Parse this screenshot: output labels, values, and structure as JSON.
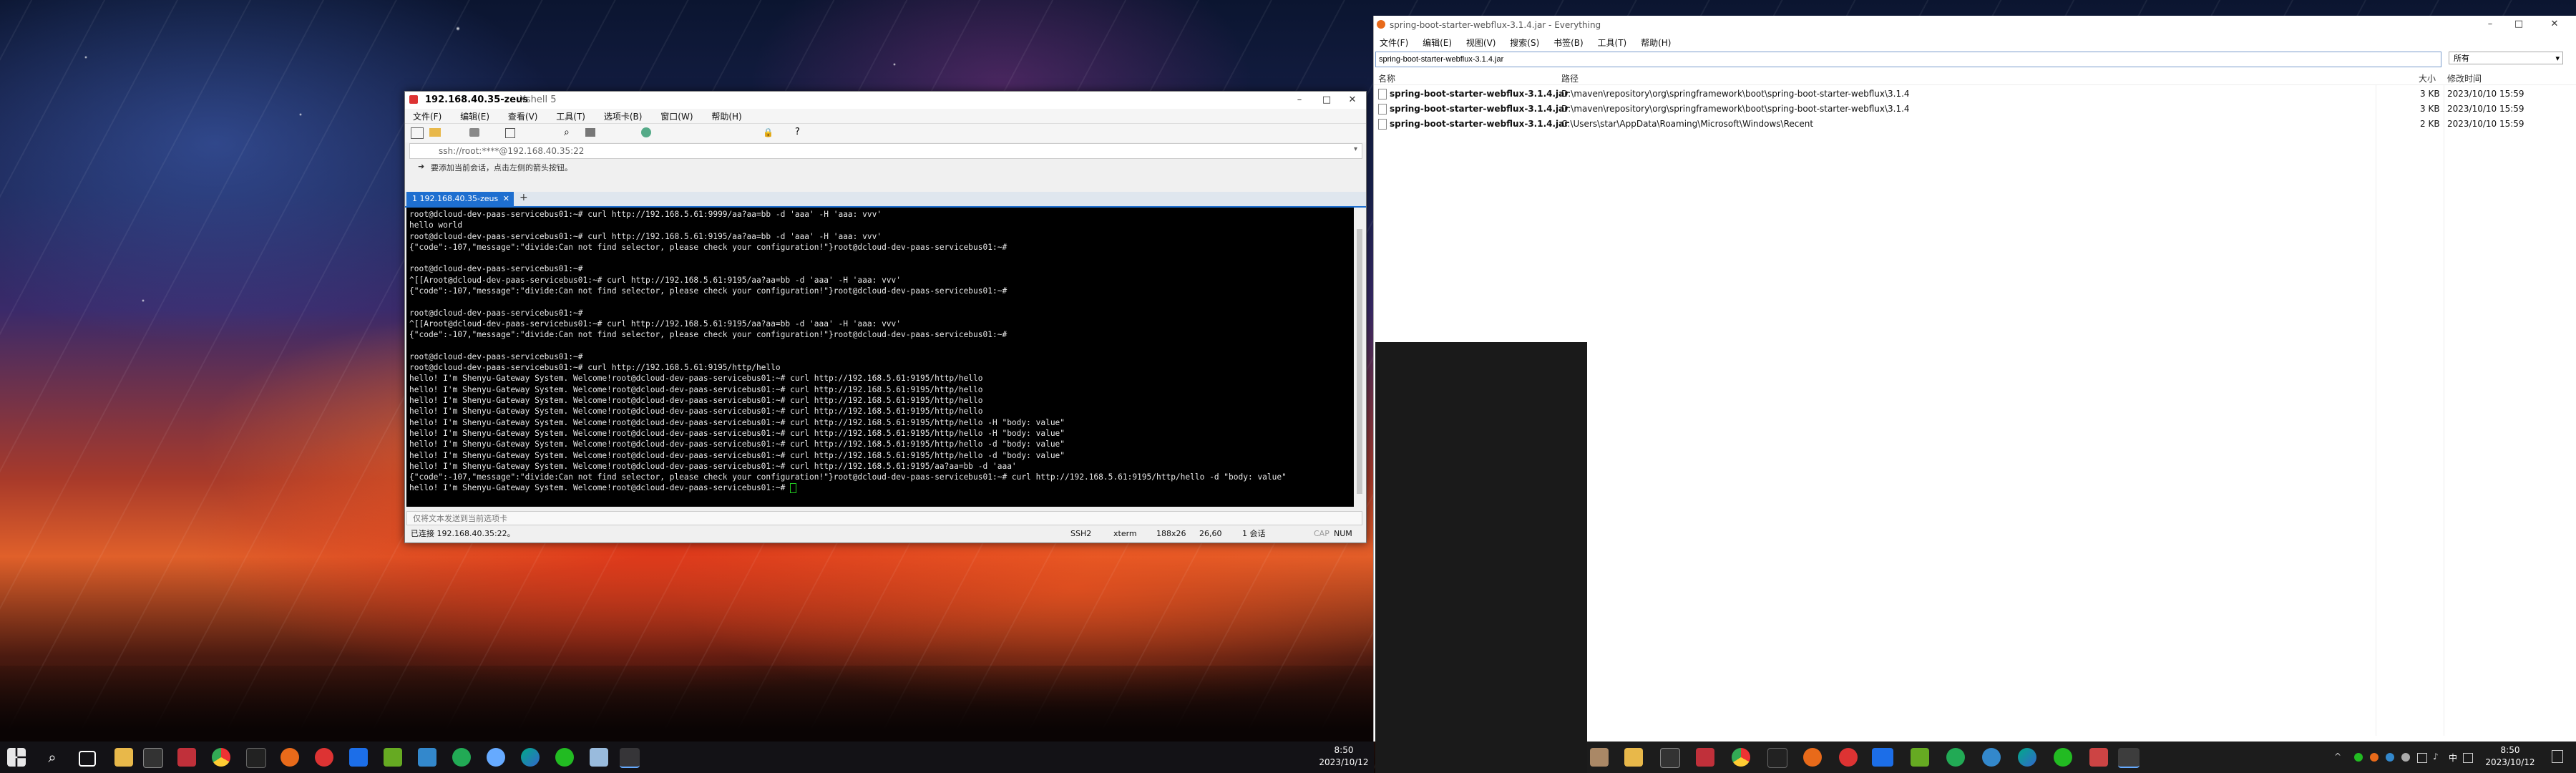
{
  "xshell": {
    "title": "192.168.40.35-zeus",
    "subtitle": "Xshell 5",
    "menu": [
      "文件(F)",
      "编辑(E)",
      "查看(V)",
      "工具(T)",
      "选项卡(B)",
      "窗口(W)",
      "帮助(H)"
    ],
    "address": "ssh://root:****@192.168.40.35:22",
    "hint": "要添加当前会话，点击左侧的箭头按钮。",
    "tab_label": "1 192.168.40.35-zeus",
    "terminal_lines": [
      "root@dcloud-dev-paas-servicebus01:~# curl http://192.168.5.61:9999/aa?aa=bb -d 'aaa' -H 'aaa: vvv'",
      "hello world",
      "root@dcloud-dev-paas-servicebus01:~# curl http://192.168.5.61:9195/aa?aa=bb -d 'aaa' -H 'aaa: vvv'",
      "{\"code\":-107,\"message\":\"divide:Can not find selector, please check your configuration!\"}root@dcloud-dev-paas-servicebus01:~#",
      "",
      "root@dcloud-dev-paas-servicebus01:~#",
      "^[[Aroot@dcloud-dev-paas-servicebus01:~# curl http://192.168.5.61:9195/aa?aa=bb -d 'aaa' -H 'aaa: vvv'",
      "{\"code\":-107,\"message\":\"divide:Can not find selector, please check your configuration!\"}root@dcloud-dev-paas-servicebus01:~#",
      "",
      "root@dcloud-dev-paas-servicebus01:~#",
      "^[[Aroot@dcloud-dev-paas-servicebus01:~# curl http://192.168.5.61:9195/aa?aa=bb -d 'aaa' -H 'aaa: vvv'",
      "{\"code\":-107,\"message\":\"divide:Can not find selector, please check your configuration!\"}root@dcloud-dev-paas-servicebus01:~#",
      "",
      "root@dcloud-dev-paas-servicebus01:~#",
      "root@dcloud-dev-paas-servicebus01:~# curl http://192.168.5.61:9195/http/hello",
      "hello! I'm Shenyu-Gateway System. Welcome!root@dcloud-dev-paas-servicebus01:~# curl http://192.168.5.61:9195/http/hello",
      "hello! I'm Shenyu-Gateway System. Welcome!root@dcloud-dev-paas-servicebus01:~# curl http://192.168.5.61:9195/http/hello",
      "hello! I'm Shenyu-Gateway System. Welcome!root@dcloud-dev-paas-servicebus01:~# curl http://192.168.5.61:9195/http/hello",
      "hello! I'm Shenyu-Gateway System. Welcome!root@dcloud-dev-paas-servicebus01:~# curl http://192.168.5.61:9195/http/hello",
      "hello! I'm Shenyu-Gateway System. Welcome!root@dcloud-dev-paas-servicebus01:~# curl http://192.168.5.61:9195/http/hello -H \"body: value\"",
      "hello! I'm Shenyu-Gateway System. Welcome!root@dcloud-dev-paas-servicebus01:~# curl http://192.168.5.61:9195/http/hello -H \"body: value\"",
      "hello! I'm Shenyu-Gateway System. Welcome!root@dcloud-dev-paas-servicebus01:~# curl http://192.168.5.61:9195/http/hello -d \"body: value\"",
      "hello! I'm Shenyu-Gateway System. Welcome!root@dcloud-dev-paas-servicebus01:~# curl http://192.168.5.61:9195/http/hello -d \"body: value\"",
      "hello! I'm Shenyu-Gateway System. Welcome!root@dcloud-dev-paas-servicebus01:~# curl http://192.168.5.61:9195/aa?aa=bb -d 'aaa'",
      "{\"code\":-107,\"message\":\"divide:Can not find selector, please check your configuration!\"}root@dcloud-dev-paas-servicebus01:~# curl http://192.168.5.61:9195/http/hello -d \"body: value\"",
      "hello! I'm Shenyu-Gateway System. Welcome!root@dcloud-dev-paas-servicebus01:~# "
    ],
    "send_placeholder": "仅将文本发送到当前选项卡",
    "status": {
      "connection": "已连接 192.168.40.35:22。",
      "protocol": "SSH2",
      "term": "xterm",
      "size": "188x26",
      "cursor": "26,60",
      "sessions": "1 会话",
      "caps": "CAP",
      "num": "NUM"
    }
  },
  "everything": {
    "title": "spring-boot-starter-webflux-3.1.4.jar - Everything",
    "menu": [
      "文件(F)",
      "编辑(E)",
      "视图(V)",
      "搜索(S)",
      "书签(B)",
      "工具(T)",
      "帮助(H)"
    ],
    "search_value": "spring-boot-starter-webflux-3.1.4.jar",
    "filter": "所有",
    "headers": {
      "name": "名称",
      "path": "路径",
      "size": "大小",
      "modified": "修改时间"
    },
    "rows": [
      {
        "name": "spring-boot-starter-webflux-3.1.4.jar",
        "path": "D:\\maven\\repository\\org\\springframework\\boot\\spring-boot-starter-webflux\\3.1.4",
        "size": "3 KB",
        "modified": "2023/10/10 15:59"
      },
      {
        "name": "spring-boot-starter-webflux-3.1.4.jar",
        "path": "D:\\maven\\repository\\org\\springframework\\boot\\spring-boot-starter-webflux\\3.1.4",
        "size": "3 KB",
        "modified": "2023/10/10 15:59"
      },
      {
        "name": "spring-boot-starter-webflux-3.1.4.jar",
        "path": "C:\\Users\\star\\AppData\\Roaming\\Microsoft\\Windows\\Recent",
        "size": "2 KB",
        "modified": "2023/10/10 15:59"
      }
    ]
  },
  "taskbar": {
    "left_time": "8:50",
    "left_date": "2023/10/12",
    "right_time": "8:50",
    "right_date": "2023/10/12",
    "ime": "中"
  }
}
